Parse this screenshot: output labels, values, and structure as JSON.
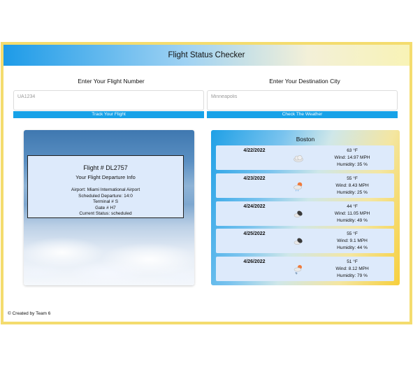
{
  "header": {
    "title": "Flight Status Checker"
  },
  "flight_search": {
    "label": "Enter Your Flight Number",
    "placeholder": "UA1234",
    "button_label": "Track Your Flight"
  },
  "city_search": {
    "label": "Enter Your Destination City",
    "placeholder": "Minneapolis",
    "button_label": "Check The Weather"
  },
  "flight": {
    "number": "Flight # DL2757",
    "subtitle": "Your Flight Departure Info",
    "airport": "Airport: Miami International Airport",
    "departure": "Scheduled Departure: 14:0",
    "terminal": "Terminal # S",
    "gate": "Gate # H7",
    "status": "Current Status: scheduled"
  },
  "weather": {
    "city": "Boston",
    "days": [
      {
        "date": "4/22/2022",
        "temp": "63 °F",
        "wind": "Wind: 14.97 MPH",
        "humidity": "Humidity: 35 %",
        "icon": "cloud-icon"
      },
      {
        "date": "4/23/2022",
        "temp": "55 °F",
        "wind": "Wind: 8.43 MPH",
        "humidity": "Humidity: 25 %",
        "icon": "sun-behind-rain-cloud-icon"
      },
      {
        "date": "4/24/2022",
        "temp": "44 °F",
        "wind": "Wind: 11.05 MPH",
        "humidity": "Humidity: 49 %",
        "icon": "dark-cloud-icon"
      },
      {
        "date": "4/25/2022",
        "temp": "55 °F",
        "wind": "Wind: 9.1 MPH",
        "humidity": "Humidity: 44 %",
        "icon": "dark-cloud-icon"
      },
      {
        "date": "4/26/2022",
        "temp": "51 °F",
        "wind": "Wind: 8.12 MPH",
        "humidity": "Humidity: 79 %",
        "icon": "sun-snow-cloud-icon"
      }
    ]
  },
  "footer": {
    "text": "© Created by Team 6"
  },
  "colors": {
    "accent": "#17a2e8",
    "frame": "#f4dc6e",
    "panel": "#ddeafb"
  }
}
